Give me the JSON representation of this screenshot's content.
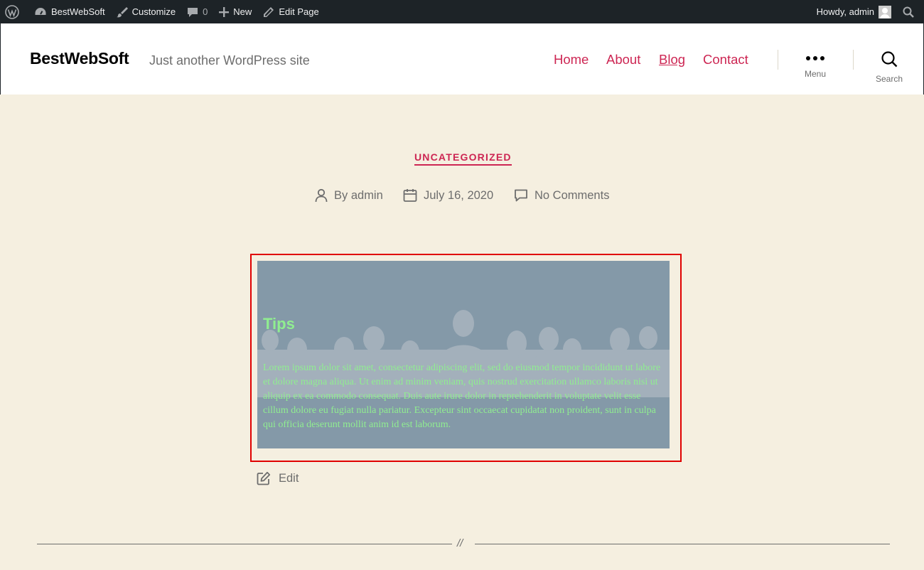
{
  "admin_bar": {
    "site_name": "BestWebSoft",
    "customize": "Customize",
    "comments_count": "0",
    "new": "New",
    "edit_page": "Edit Page",
    "howdy": "Howdy, admin"
  },
  "header": {
    "site_title": "BestWebSoft",
    "tagline": "Just another WordPress site",
    "nav": [
      "Home",
      "About",
      "Blog",
      "Contact"
    ],
    "menu_label": "Menu",
    "search_label": "Search"
  },
  "post": {
    "category": "UNCATEGORIZED",
    "author": "By admin",
    "date": "July 16, 2020",
    "comments": "No Comments",
    "edit": "Edit"
  },
  "cover_block": {
    "title": "Tips",
    "text": "Lorem ipsum dolor sit amet, consectetur adipiscing elit, sed do eiusmod tempor incididunt ut labore et dolore magna aliqua. Ut enim ad minim veniam, quis nostrud exercitation ullamco laboris nisi ut aliquip ex ea commodo consequat. Duis aute irure dolor in reprehenderit in voluptate velit esse cillum dolore eu fugiat nulla pariatur. Excepteur sint occaecat cupidatat non proident, sunt in culpa qui officia deserunt mollit anim id est laborum."
  },
  "separator": {
    "mark": "//"
  },
  "colors": {
    "accent": "#cd2653",
    "background": "#f5efe0",
    "admin_bar": "#1d2327",
    "cover_bg": "#8499a8",
    "cover_text": "#90ee90",
    "highlight": "#e00000"
  }
}
